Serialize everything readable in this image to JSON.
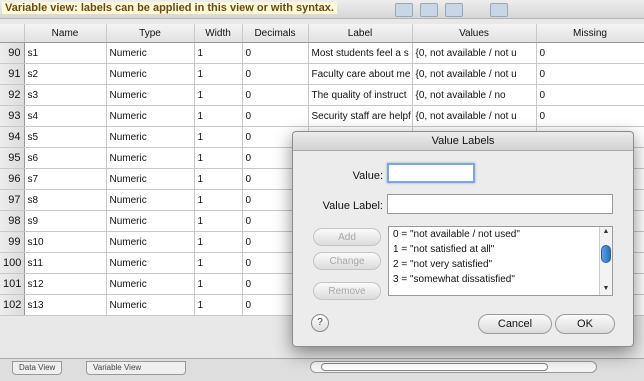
{
  "caption": "Variable view: labels can be applied in this view or with syntax.",
  "columns": [
    "Name",
    "Type",
    "Width",
    "Decimals",
    "Label",
    "Values",
    "Missing"
  ],
  "rows": [
    {
      "num": "90",
      "name": "s1",
      "type": "Numeric",
      "width": "1",
      "decimals": "0",
      "label": "Most students feel a s",
      "values": "{0, not available / not u",
      "missing": "0"
    },
    {
      "num": "91",
      "name": "s2",
      "type": "Numeric",
      "width": "1",
      "decimals": "0",
      "label": "Faculty care about me",
      "values": "{0, not available / not u",
      "missing": "0"
    },
    {
      "num": "92",
      "name": "s3",
      "type": "Numeric",
      "width": "1",
      "decimals": "0",
      "label": "The quality of instruct",
      "values": "{0, not available / no",
      "missing": "0"
    },
    {
      "num": "93",
      "name": "s4",
      "type": "Numeric",
      "width": "1",
      "decimals": "0",
      "label": "Security staff are helpf",
      "values": "{0, not available / not u",
      "missing": "0"
    },
    {
      "num": "94",
      "name": "s5",
      "type": "Numeric",
      "width": "1",
      "decimals": "0",
      "label": "",
      "values": "",
      "missing": ""
    },
    {
      "num": "95",
      "name": "s6",
      "type": "Numeric",
      "width": "1",
      "decimals": "0",
      "label": "",
      "values": "",
      "missing": ""
    },
    {
      "num": "96",
      "name": "s7",
      "type": "Numeric",
      "width": "1",
      "decimals": "0",
      "label": "",
      "values": "",
      "missing": ""
    },
    {
      "num": "97",
      "name": "s8",
      "type": "Numeric",
      "width": "1",
      "decimals": "0",
      "label": "",
      "values": "",
      "missing": ""
    },
    {
      "num": "98",
      "name": "s9",
      "type": "Numeric",
      "width": "1",
      "decimals": "0",
      "label": "",
      "values": "",
      "missing": ""
    },
    {
      "num": "99",
      "name": "s10",
      "type": "Numeric",
      "width": "1",
      "decimals": "0",
      "label": "",
      "values": "",
      "missing": ""
    },
    {
      "num": "100",
      "name": "s11",
      "type": "Numeric",
      "width": "1",
      "decimals": "0",
      "label": "",
      "values": "",
      "missing": ""
    },
    {
      "num": "101",
      "name": "s12",
      "type": "Numeric",
      "width": "1",
      "decimals": "0",
      "label": "",
      "values": "",
      "missing": ""
    },
    {
      "num": "102",
      "name": "s13",
      "type": "Numeric",
      "width": "1",
      "decimals": "0",
      "label": "",
      "values": "",
      "missing": ""
    }
  ],
  "bottom": {
    "tab_data": "Data View",
    "tab_variable": "Variable View"
  },
  "dialog": {
    "title": "Value Labels",
    "value_label": "Value:",
    "value_field": "",
    "value_label_label": "Value Label:",
    "value_label_field": "",
    "add": "Add",
    "change": "Change",
    "remove": "Remove",
    "list": [
      "0 = \"not available / not used\"",
      "1 = \"not satisfied at all\"",
      "2 = \"not very satisfied\"",
      "3 = \"somewhat dissatisfied\""
    ],
    "help": "?",
    "cancel": "Cancel",
    "ok": "OK"
  },
  "colors": {
    "focus_ring": "#7ea7d8",
    "scroll_thumb": "#2f6fc0",
    "caption_text": "#6b4a17"
  },
  "icons": [
    "question-mark-icon",
    "scroll-up-arrow-icon",
    "scroll-down-arrow-icon"
  ]
}
